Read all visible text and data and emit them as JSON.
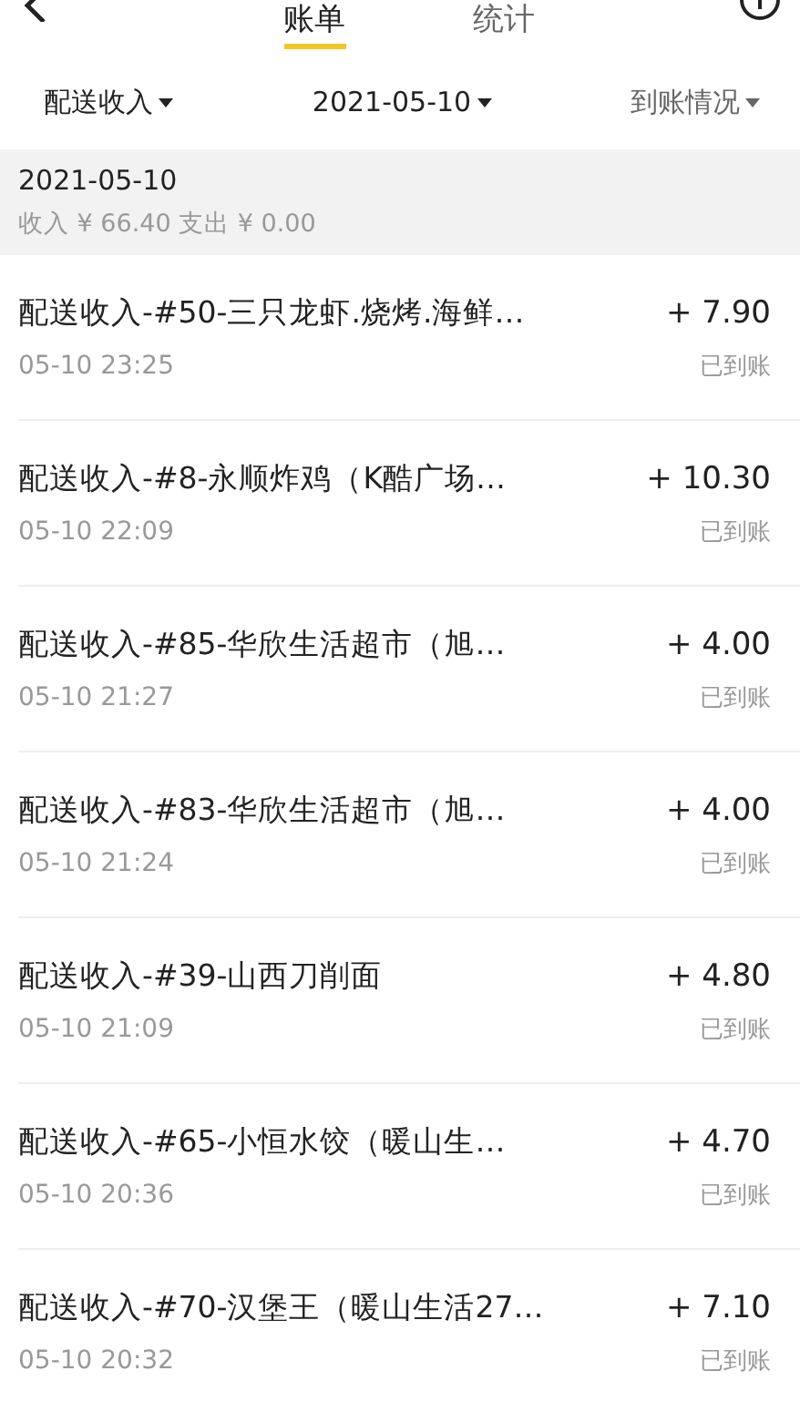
{
  "tabs": [
    {
      "label": "账单",
      "selected": true
    },
    {
      "label": "统计",
      "selected": false
    }
  ],
  "filters": [
    {
      "label": "配送收入",
      "muted": false
    },
    {
      "label": "2021-05-10",
      "muted": false
    },
    {
      "label": "到账情况",
      "muted": true
    }
  ],
  "summary": {
    "date": "2021-05-10",
    "totals": "收入 ¥ 66.40 支出 ¥ 0.00"
  },
  "records": [
    {
      "title": "配送收入-#50-三只龙虾.烧烤.海鲜…",
      "amount": "+ 7.90",
      "time": "05-10 23:25",
      "status": "已到账"
    },
    {
      "title": "配送收入-#8-永顺炸鸡（K酷广场…",
      "amount": "+ 10.30",
      "time": "05-10 22:09",
      "status": "已到账"
    },
    {
      "title": "配送收入-#85-华欣生活超市（旭…",
      "amount": "+ 4.00",
      "time": "05-10 21:27",
      "status": "已到账"
    },
    {
      "title": "配送收入-#83-华欣生活超市（旭…",
      "amount": "+ 4.00",
      "time": "05-10 21:24",
      "status": "已到账"
    },
    {
      "title": "配送收入-#39-山西刀削面",
      "amount": "+ 4.80",
      "time": "05-10 21:09",
      "status": "已到账"
    },
    {
      "title": "配送收入-#65-小恒水饺（暖山生…",
      "amount": "+ 4.70",
      "time": "05-10 20:36",
      "status": "已到账"
    },
    {
      "title": "配送收入-#70-汉堡王（暖山生活27…",
      "amount": "+ 7.10",
      "time": "05-10 20:32",
      "status": "已到账"
    }
  ]
}
